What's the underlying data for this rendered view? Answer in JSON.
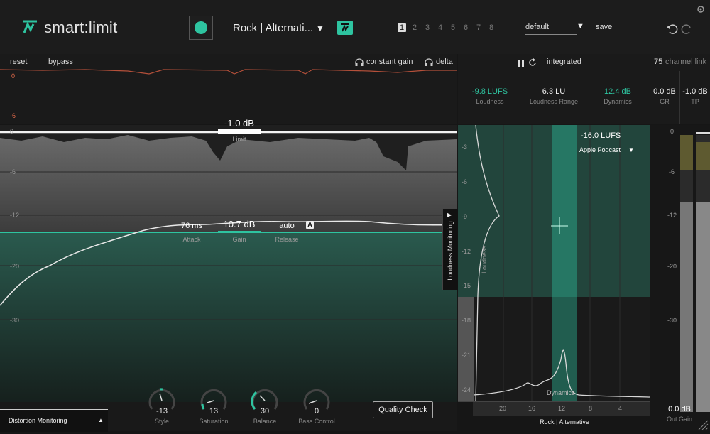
{
  "app": {
    "name": "smart:limit"
  },
  "header": {
    "preset": "Rock | Alternati...",
    "slots": [
      "1",
      "2",
      "3",
      "4",
      "5",
      "6",
      "7",
      "8"
    ],
    "profile": "default",
    "save_label": "save"
  },
  "toolbar": {
    "reset": "reset",
    "bypass": "bypass",
    "constant_gain": "constant gain",
    "delta": "delta",
    "mode": "integrated",
    "channel_link_value": "75",
    "channel_link_label": "channel link"
  },
  "stats": {
    "loudness": {
      "value": "-9.8 LUFS",
      "label": "Loudness"
    },
    "loudness_range": {
      "value": "6.3 LU",
      "label": "Loudness Range"
    },
    "dynamics": {
      "value": "12.4 dB",
      "label": "Dynamics"
    },
    "gr": {
      "value": "0.0 dB",
      "label": "GR"
    },
    "tp": {
      "value": "-1.0 dB",
      "label": "TP"
    }
  },
  "history_axis": [
    "0",
    "-6"
  ],
  "main": {
    "limit": {
      "value": "-1.0 dB",
      "label": "Limit"
    },
    "attack": {
      "value": "76 ms",
      "label": "Attack"
    },
    "gain": {
      "value": "10.7 dB",
      "label": "Gain"
    },
    "release": {
      "value": "auto",
      "label": "Release",
      "badge": "A"
    },
    "axis": [
      "0",
      "-6",
      "-12",
      "-20",
      "-30"
    ],
    "side_tab": "Loudness Monitoring"
  },
  "monitor": {
    "target_value": "-16.0 LUFS",
    "target_profile": "Apple Podcast",
    "axis": [
      "-3",
      "-6",
      "-9",
      "-12",
      "-15",
      "-18",
      "-21",
      "-24"
    ],
    "loudness_label": "Loudness",
    "dynamics_label": "Dynamics",
    "x_axis": [
      "20",
      "16",
      "12",
      "8",
      "4"
    ],
    "genre": "Rock | Alternative"
  },
  "meter": {
    "axis": [
      "0",
      "-6",
      "-12",
      "-20",
      "-30"
    ],
    "out_gain_value": "0.0 dB",
    "out_gain_label": "Out Gain"
  },
  "bottom": {
    "distortion_monitoring": "Distortion Monitoring",
    "knobs": [
      {
        "value": "-13",
        "label": "Style"
      },
      {
        "value": "13",
        "label": "Saturation"
      },
      {
        "value": "30",
        "label": "Balance"
      },
      {
        "value": "0",
        "label": "Bass Control"
      }
    ],
    "quality_check": "Quality Check"
  },
  "colors": {
    "accent": "#2ec4a0",
    "history_line": "#b5503a"
  }
}
